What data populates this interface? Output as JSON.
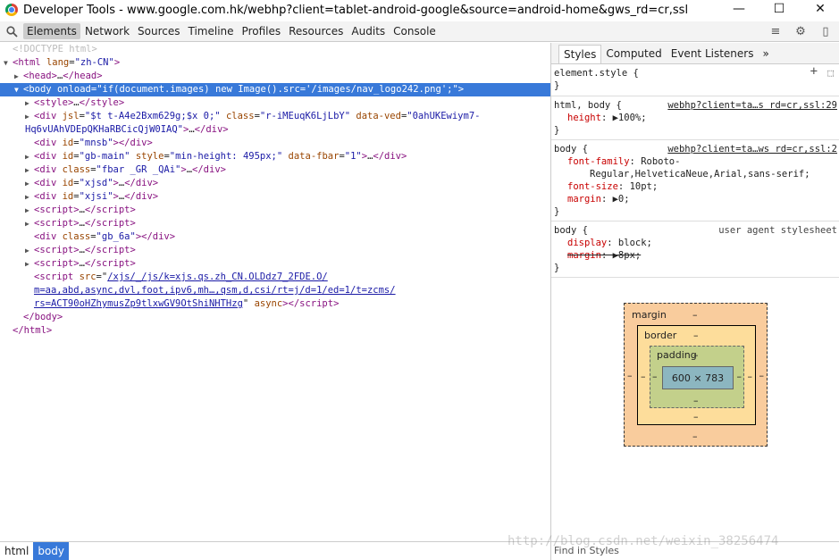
{
  "window": {
    "title": "Developer Tools - www.google.com.hk/webhp?client=tablet-android-google&source=android-home&gws_rd=cr,ssl",
    "minimize": "—",
    "maximize": "☐",
    "close": "✕"
  },
  "toolbar": {
    "tabs": [
      "Elements",
      "Network",
      "Sources",
      "Timeline",
      "Profiles",
      "Resources",
      "Audits",
      "Console"
    ],
    "active_tab": "Elements",
    "drawer_icon": "≡",
    "settings_icon": "⚙",
    "dock_icon": "▯"
  },
  "dom": {
    "doctype": "<!DOCTYPE html>",
    "html_open": "html",
    "html_lang_attr": "lang",
    "html_lang_val": "\"zh-CN\"",
    "head": "head",
    "body_onload_attr": "onload",
    "body_onload_val": "\"if(document.images) new Image().src='/images/nav_logo242.png';\"",
    "style": "style",
    "div1_jsl": "\"$t t-A4e2Bxm629g;$x 0;\"",
    "div1_class": "\"r-iMEuqK6LjLbY\"",
    "div1_ved_a": "\"0ahUKEwiym7-",
    "div1_ved_b": "Hq6vUAhVDEpQKHaRBCicQjW0IAQ\"",
    "mnsb": "\"mnsb\"",
    "gbmain": "\"gb-main\"",
    "gbmain_style": "\"min-height: 495px;\"",
    "fbar_attr": "\"1\"",
    "fbar_class": "\"fbar _GR _QAi\"",
    "xjsd": "\"xjsd\"",
    "xjsi": "\"xjsi\"",
    "gb6a": "\"gb_6a\"",
    "script_src_a": "/xjs/_/js/k=xjs.qs.zh_CN.OLDdz7_2FDE.O/",
    "script_src_b": "m=aa,abd,async,dvl,foot,ipv6,mh…,qsm,d,csi/rt=j/d=1/ed=1/t=zcms/",
    "script_src_c": "rs=ACT90oHZhymusZp9tlxwGV9OtShiNHTHzg",
    "async": "async"
  },
  "breadcrumbs": [
    "html",
    "body"
  ],
  "styles": {
    "tabs": [
      "Styles",
      "Computed",
      "Event Listeners"
    ],
    "more": "»",
    "rules": [
      {
        "selector": "element.style {",
        "source": "",
        "props": []
      },
      {
        "selector": "html, body {",
        "source": "webhp?client=ta…s rd=cr,ssl:29",
        "props": [
          {
            "name": "height",
            "value": "100%;"
          }
        ]
      },
      {
        "selector": "body {",
        "source": "webhp?client=ta…ws rd=cr,ssl:2",
        "props": [
          {
            "name": "font-family",
            "value": "Roboto-"
          },
          {
            "name": "font-size",
            "value": "10pt;"
          },
          {
            "name": "margin",
            "value": "0;"
          }
        ],
        "cont": "Regular,HelveticaNeue,Arial,sans-serif;"
      },
      {
        "selector": "body {",
        "source": "user agent stylesheet",
        "props": [
          {
            "name": "display",
            "value": "block;"
          },
          {
            "name": "margin",
            "value": "8px;"
          }
        ]
      }
    ],
    "close_brace": "}"
  },
  "boxmodel": {
    "margin": "margin",
    "border": "border",
    "padding": "padding",
    "content": "600 × 783",
    "dash": "–"
  },
  "find": "Find in Styles",
  "watermark": "http://blog.csdn.net/weixin_38256474"
}
